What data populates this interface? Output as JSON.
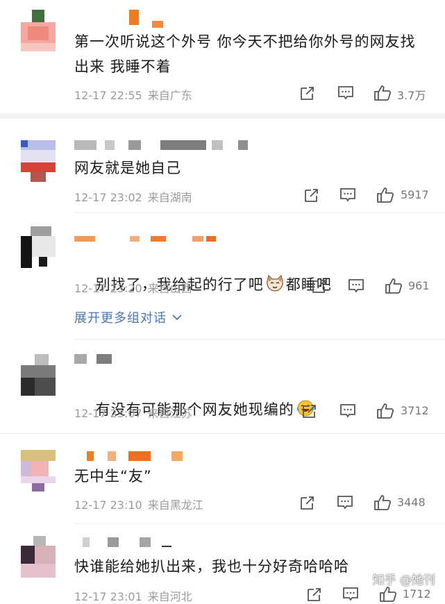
{
  "comments": [
    {
      "text": "第一次听说这个外号 你今天不把给你外号的网友找出来 我睡不着",
      "date": "12-17 22:55",
      "location": "来自广东",
      "likes": "3.7万"
    },
    {
      "text": "网友就是她自己",
      "date": "12-17 23:02",
      "location": "来自湖南",
      "likes": "5917"
    },
    {
      "text_before": "别找了，我给起的行了吧",
      "text_after": "都睡吧",
      "date": "12-17 23:20",
      "location": "来自山西",
      "likes": "961",
      "expand_label": "展开更多组对话"
    },
    {
      "text": "有没有可能那个网友她现编的",
      "date": "12-17 23:07",
      "location": "来自江苏",
      "likes": "3712"
    },
    {
      "text": "无中生“友”",
      "date": "12-17 23:10",
      "location": "来自黑龙江",
      "likes": "3448"
    },
    {
      "text": "快谁能给她扒出来，我也十分好奇哈哈哈",
      "date": "12-17 23:01",
      "location": "来自河北",
      "likes": "1712"
    }
  ],
  "watermark": "知乎 @她刊",
  "icons": [
    "share-icon",
    "comment-icon",
    "like-icon"
  ],
  "colors": {
    "link": "#4a74b5",
    "meta": "#9a9a9a",
    "text": "#1a1a1a"
  }
}
